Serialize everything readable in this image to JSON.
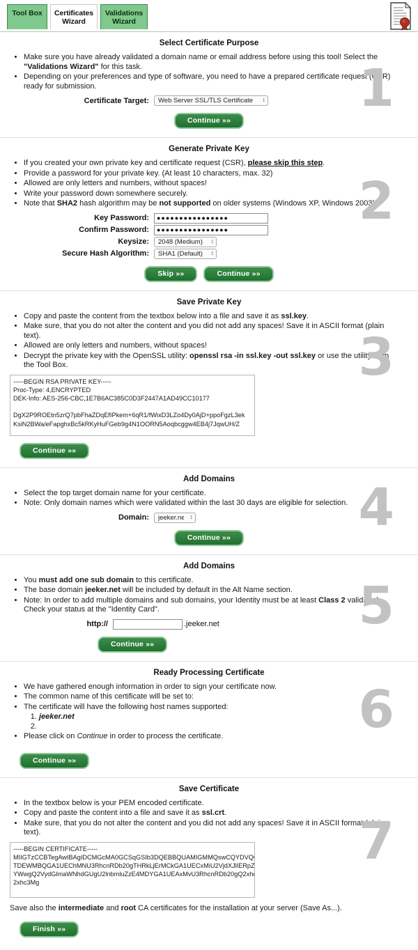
{
  "tabs": [
    {
      "id": "tool-box",
      "line1": "Tool Box",
      "line2": "",
      "active": false
    },
    {
      "id": "certificates",
      "line1": "Certificates",
      "line2": "Wizard",
      "active": true
    },
    {
      "id": "validations",
      "line1": "Validations",
      "line2": "Wizard",
      "active": false
    }
  ],
  "header": {
    "doc_icon": "certificate-seal-icon"
  },
  "colors": {
    "tab_green": "#7ec98b",
    "tab_border": "#3f8a4f",
    "button_green": "#2b7c3b",
    "button_border": "#8fc79a",
    "step_number": "#c2c2c2",
    "rule": "#e2e2e2"
  },
  "steps": {
    "one": "1",
    "two": "2",
    "three": "3",
    "four": "4",
    "five": "5",
    "six": "6",
    "seven": "7"
  },
  "s1": {
    "title": "Select Certificate Purpose",
    "b1_a": "Make sure you have already validated a domain name or email address before using this tool! Select the ",
    "b1_strong": "\"Validations Wizard\"",
    "b1_b": " for this task.",
    "b2": "Depending on your preferences and type of software, you need to have a prepared certificate request (CSR) ready for submission.",
    "target_label": "Certificate Target:",
    "target_value": "Web Server SSL/TLS Certificate",
    "target_options": [
      "Web Server SSL/TLS Certificate"
    ],
    "continue": "Continue »»"
  },
  "s2": {
    "title": "Generate Private Key",
    "b1_a": "If you created your own private key and certificate request (CSR), ",
    "b1_link": "please skip this step",
    "b1_b": ".",
    "b2": "Provide a password for your private key. (At least 10 characters, max. 32)",
    "b3": "Allowed are only letters and numbers, without spaces!",
    "b4": "Write your password down somewhere securely.",
    "b5_a": "Note that ",
    "b5_strong1": "SHA2",
    "b5_b": " hash algorithm may be ",
    "b5_strong2": "not supported",
    "b5_c": " on older systems (Windows XP, Windows 2003).",
    "key_password_label": "Key Password:",
    "key_password_value": "●●●●●●●●●●●●●●●●",
    "confirm_password_label": "Confirm Password:",
    "confirm_password_value": "●●●●●●●●●●●●●●●●",
    "keysize_label": "Keysize:",
    "keysize_value": "2048 (Medium)",
    "keysize_options": [
      "2048 (Medium)"
    ],
    "hash_label": "Secure Hash Algorithm:",
    "hash_value": "SHA1 (Default)",
    "hash_options": [
      "SHA1 (Default)"
    ],
    "skip": "Skip »»",
    "continue": "Continue »»"
  },
  "s3": {
    "title": "Save Private Key",
    "b1_a": "Copy and paste the content from the textbox below into a file and save it as ",
    "b1_strong": "ssl.key",
    "b1_b": ".",
    "b2": "Make sure, that you do not alter the content and you did not add any spaces! Save it in ASCII format (plain text).",
    "b3": "Allowed are only letters and numbers, without spaces!",
    "b4_a": "Decrypt the private key with the OpenSSL utility: ",
    "b4_strong": "openssl rsa -in ssl.key -out ssl.key",
    "b4_b": " or use the utility from the Tool Box.",
    "textarea_value": "-----BEGIN RSA PRIVATE KEY-----\nProc-Type: 4,ENCRYPTED\nDEK-Info: AES-256-CBC,1E7B6AC385C0D3F2447A1AD49CC10177\n\nDgX2P9ROEtn5zrQ7pbFhaZDqEfIPkem+6qR1/fWixD3LZo4Dy0AjD+ppoFgzL3ek\nKsiN2BWa/eFapghxBc5kRKyHuFGeb9g4N1OORN5Aoqbcggw4EB4j7JqwUH/Z",
    "continue": "Continue »»"
  },
  "s4": {
    "title": "Add Domains",
    "b1": "Select the top target domain name for your certificate.",
    "b2": "Note: Only domain names which were validated within the last 30 days are eligible for selection.",
    "domain_label": "Domain:",
    "domain_value": "jeeker.net",
    "domain_options": [
      "jeeker.net"
    ],
    "continue": "Continue »»"
  },
  "s5": {
    "title": "Add Domains",
    "b1_a": "You ",
    "b1_strong": "must add one sub domain",
    "b1_b": " to this certificate.",
    "b2_a": "The base domain ",
    "b2_strong": "jeeker.net",
    "b2_b": " will be included by default in the Alt Name section.",
    "b3_a": "Note: In order to add multiple domains and sub domains, your Identity must be at least ",
    "b3_strong": "Class 2",
    "b3_b": " validated. Check your status at the \"Identity Card\".",
    "protocol_label": "http://",
    "subdomain_value": "",
    "subdomain_placeholder": "",
    "domain_suffix": ".jeeker.net",
    "continue": "Continue »»"
  },
  "s6": {
    "title": "Ready Processing Certificate",
    "b1": "We have gathered enough information in order to sign your certificate now.",
    "b2": "The common name of this certificate will be set to:",
    "b3": "The certificate will have the following host names supported:",
    "host1": "jeeker.net",
    "host2": "",
    "b4_a": "Please click on ",
    "b4_em": "Continue",
    "b4_b": " in order to process the certificate.",
    "continue": "Continue »»"
  },
  "s7": {
    "title": "Save Certificate",
    "b1": "In the textbox below is your PEM encoded certificate.",
    "b2_a": "Copy and paste the content into a file and save it as ",
    "b2_strong": "ssl.crt",
    "b2_b": ".",
    "b3": "Make sure, that you do not alter the content and you did not add any spaces! Save it in ASCII format (plain text).",
    "textarea_value": "-----BEGIN CERTIFICATE-----\nMIIGTzCCBTegAwIBAgIDCMGcMA0GCSqGSIb3DQEBBQUAMIGMMQswCQYDVQQGEwJJ\nTDEWMBQGA1UEChMNU3RhcnRDb20gTHRkLjErMCkGA1UECxMiU2VjdXJlIERpZ2l0\nYWwgQ2VydGlmaWNhdGUgU2lnbmluZzE4MDYGA1UEAxMvU3RhcnRDb20gQ2xhc3Mg\n2xhc3Mg",
    "footnote_a": "Save also the ",
    "footnote_strong1": "intermediate",
    "footnote_b": " and ",
    "footnote_strong2": "root",
    "footnote_c": " CA certificates for the installation at your server (Save As...).",
    "finish": "Finish »»"
  }
}
